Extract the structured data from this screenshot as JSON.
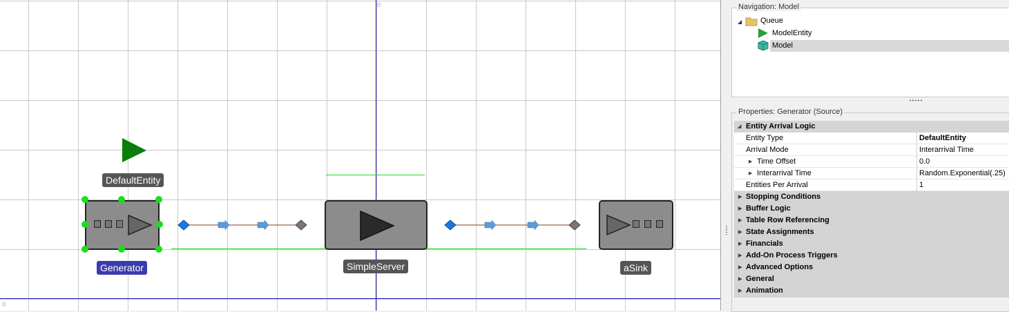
{
  "canvas": {
    "axis_origin_top": "0",
    "axis_origin_left": "0",
    "objects": {
      "entity_label": "DefaultEntity",
      "generator_label": "Generator",
      "server_label": "SimpleServer",
      "sink_label": "aSink"
    }
  },
  "navigation": {
    "title": "Navigation: Model",
    "items": [
      {
        "label": "Queue",
        "icon": "folder-icon"
      },
      {
        "label": "ModelEntity",
        "icon": "entity-triangle-icon"
      },
      {
        "label": "Model",
        "icon": "model-cube-icon",
        "selected": true
      }
    ]
  },
  "properties": {
    "title": "Properties: Generator (Source)",
    "category_open": "Entity Arrival Logic",
    "rows": [
      {
        "name": "Entity Type",
        "value": "DefaultEntity",
        "bold_value": true
      },
      {
        "name": "Arrival Mode",
        "value": "Interarrival Time"
      },
      {
        "name": "Time Offset",
        "value": "0.0",
        "expandable": true
      },
      {
        "name": "Interarrival Time",
        "value": "Random.Exponential(.25)",
        "expandable": true
      },
      {
        "name": "Entities Per Arrival",
        "value": "1"
      }
    ],
    "categories": [
      "Stopping Conditions",
      "Buffer Logic",
      "Table Row Referencing",
      "State Assignments",
      "Financials",
      "Add-On Process Triggers",
      "Advanced Options",
      "General",
      "Animation"
    ]
  },
  "colors": {
    "axis": "#1a1ab8",
    "selection": "#19e019",
    "entity": "#0a7d0a",
    "selected_label": "#3b3bb0"
  }
}
